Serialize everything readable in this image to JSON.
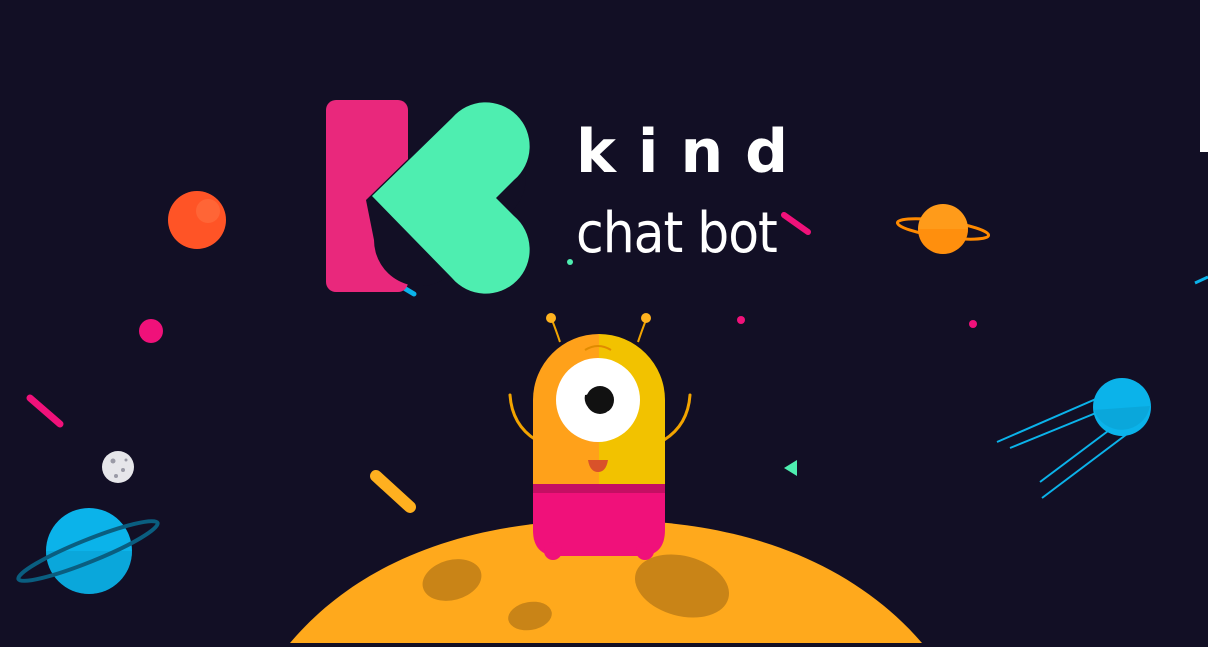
{
  "brand": {
    "name": "kind",
    "tagline": "chat bot"
  },
  "colors": {
    "background": "#120f25",
    "logo_pink": "#e9287c",
    "logo_green": "#4eeeb0",
    "moon": "#ffa91c",
    "robot_orange": "#ffa11a",
    "robot_yellow": "#f2c200",
    "robot_pink": "#f0117a",
    "planet_blue": "#0bb3ea",
    "planet_red": "#ff5426"
  },
  "icons": [
    "kind-logo-icon",
    "robot-mascot-icon",
    "moon-planet-icon",
    "ringed-planet-icon",
    "satellite-icon",
    "asteroid-icon"
  ]
}
